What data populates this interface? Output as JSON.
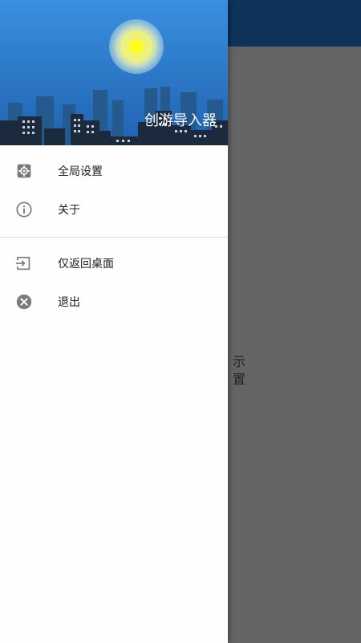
{
  "app": {
    "hint_lines": [
      "示",
      "置"
    ]
  },
  "drawer": {
    "header": {
      "app_name": "创游导入器"
    },
    "items": [
      {
        "label": "全局设置",
        "icon": "gear-icon"
      },
      {
        "label": "关于",
        "icon": "info-icon"
      }
    ],
    "secondary_items": [
      {
        "label": "仅返回桌面",
        "icon": "exit-to-app-icon"
      },
      {
        "label": "退出",
        "icon": "close-circle-icon"
      }
    ]
  },
  "colors": {
    "toolbar": "#0d3358",
    "sky_top": "#2f83d6",
    "sky_bottom": "#1a5aa6",
    "sun": "#f2f230",
    "icon": "#7a7a7a"
  }
}
